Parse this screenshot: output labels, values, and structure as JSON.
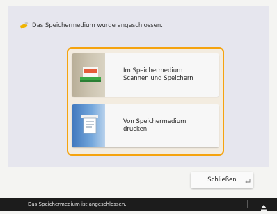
{
  "dialog": {
    "message": "Das Speichermedium wurde angeschlossen.",
    "message_icon": "usb-stick-icon",
    "options": [
      {
        "line1": "Im Speichermedium",
        "line2": "Scannen und Speichern",
        "icon": "scan-to-media-icon"
      },
      {
        "line1": "Von Speichermedium",
        "line2": "drucken",
        "icon": "print-from-media-icon"
      }
    ],
    "close_label": "Schließen"
  },
  "status_bar": {
    "text": "Das Speichermedium ist angeschlossen.",
    "eject_icon": "eject-icon"
  },
  "colors": {
    "highlight": "#f5a30e",
    "status_bar": "#1c1c1c",
    "panel": "#e6e6ee"
  }
}
